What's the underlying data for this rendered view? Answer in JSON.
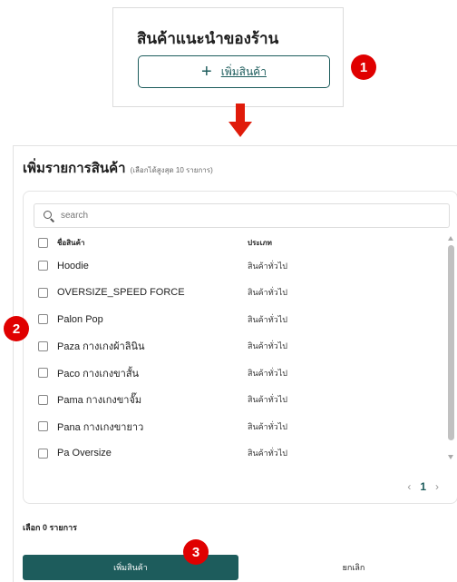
{
  "recommend_card": {
    "title": "สินค้าแนะนำของร้าน",
    "add_button_icon": "plus-icon",
    "add_button_plus": "+",
    "add_button_label": "เพิ่มสินค้า"
  },
  "badges": {
    "step1": "1",
    "step2": "2",
    "step3": "3"
  },
  "modal": {
    "title": "เพิ่มรายการสินค้า",
    "subtitle": "(เลือกได้สูงสุด 10 รายการ)",
    "search_placeholder": "search",
    "columns": {
      "name": "ชื่อสินค้า",
      "type": "ประเภท"
    },
    "rows": [
      {
        "name": "Hoodie",
        "type": "สินค้าทั่วไป"
      },
      {
        "name": "OVERSIZE_SPEED FORCE",
        "type": "สินค้าทั่วไป"
      },
      {
        "name": "Palon Pop",
        "type": "สินค้าทั่วไป"
      },
      {
        "name": "Paza กางเกงผ้าลินิน",
        "type": "สินค้าทั่วไป"
      },
      {
        "name": "Paco กางเกงขาสั้น",
        "type": "สินค้าทั่วไป"
      },
      {
        "name": "Pama กางเกงขาจั๊ม",
        "type": "สินค้าทั่วไป"
      },
      {
        "name": "Pana กางเกงขายาว",
        "type": "สินค้าทั่วไป"
      },
      {
        "name": "Pa Oversize",
        "type": "สินค้าทั่วไป"
      }
    ],
    "pagination": {
      "prev": "‹",
      "page": "1",
      "next": "›"
    },
    "selected_count": "เลือก 0 รายการ",
    "add_button": "เพิ่มสินค้า",
    "cancel_button": "ยกเลิก"
  },
  "colors": {
    "accent": "#1d5c5c",
    "badge": "#e00000",
    "arrow": "#e01b0a"
  }
}
